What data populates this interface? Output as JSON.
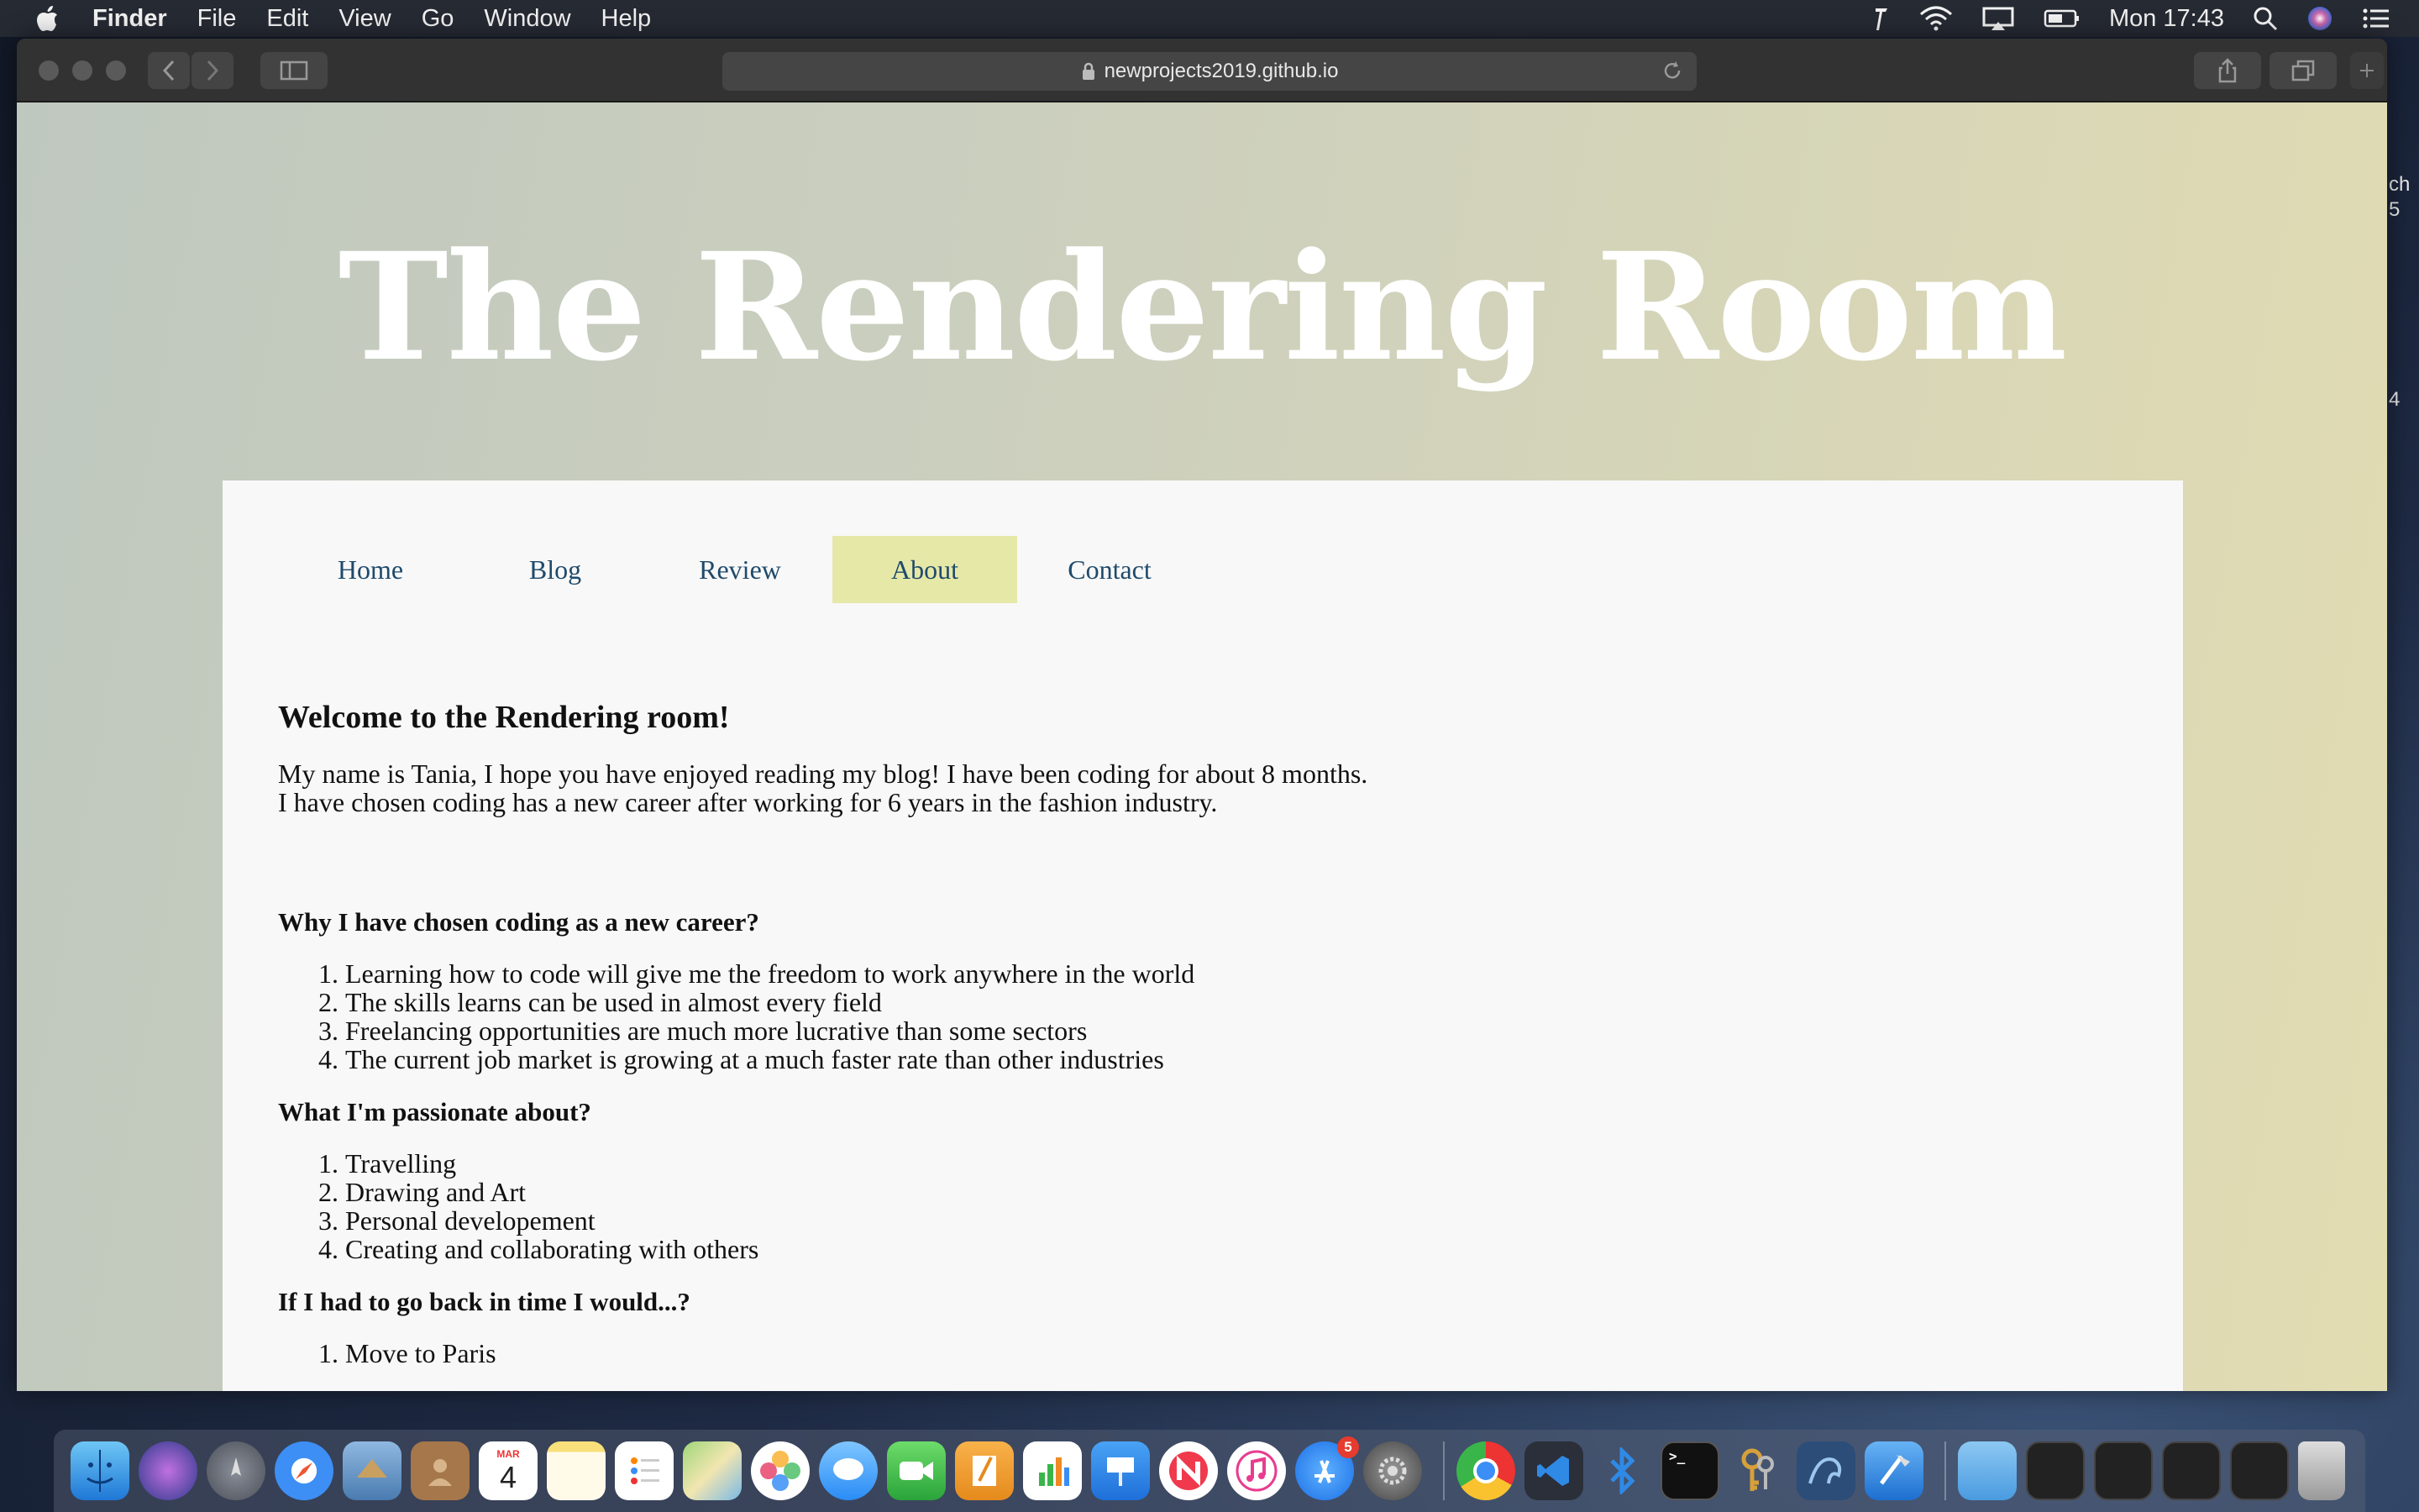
{
  "menubar": {
    "app_name": "Finder",
    "items": [
      "File",
      "Edit",
      "View",
      "Go",
      "Window",
      "Help"
    ],
    "clock": "Mon 17:43"
  },
  "browser": {
    "url": "newprojects2019.github.io"
  },
  "site": {
    "title": "The Rendering Room",
    "nav": [
      {
        "label": "Home"
      },
      {
        "label": "Blog"
      },
      {
        "label": "Review"
      },
      {
        "label": "About"
      },
      {
        "label": "Contact"
      }
    ],
    "active_nav": "About"
  },
  "article": {
    "heading": "Welcome to the Rendering room!",
    "intro_line1": "My name is Tania, I hope you have enjoyed reading my blog! I have been coding for about 8 months.",
    "intro_line2": "I have chosen coding has a new career after working for 6 years in the fashion industry.",
    "sections": [
      {
        "title": "Why I have chosen coding as a new career?",
        "items": [
          "Learning how to code will give me the freedom to work anywhere in the world",
          "The skills learns can be used in almost every field",
          "Freelancing opportunities are much more lucrative than some sectors",
          "The current job market is growing at a much faster rate than other industries"
        ]
      },
      {
        "title": "What I'm passionate about?",
        "items": [
          "Travelling",
          "Drawing and Art",
          "Personal developement",
          "Creating and collaborating with others"
        ]
      },
      {
        "title": "If I had to go back in time I would...?",
        "items": [
          "Move to Paris"
        ]
      }
    ]
  },
  "dock": {
    "calendar_month": "MAR",
    "calendar_day": "4",
    "appstore_badge": "5",
    "apps": [
      "finder-icon",
      "siri-icon",
      "launchpad-icon",
      "safari-icon",
      "mail-icon",
      "contacts-icon",
      "calendar-icon",
      "notes-icon",
      "reminders-icon",
      "maps-icon",
      "photos-icon",
      "messages-icon",
      "facetime-icon",
      "pages-icon",
      "numbers-icon",
      "keynote-icon",
      "news-icon",
      "itunes-icon",
      "app-store-icon",
      "system-preferences-icon",
      "chrome-icon",
      "vscode-icon",
      "bluetooth-icon",
      "terminal-icon",
      "keychain-icon",
      "mysql-workbench-icon",
      "xcode-icon",
      "downloads-folder-icon",
      "trash-icon"
    ]
  },
  "colors": {
    "nav_text": "#1f4a6b",
    "nav_active_bg": "#e6e8a8",
    "card_bg": "#f8f8f8"
  },
  "side_text": {
    "a": "ch",
    "b": "5",
    "c": "4"
  }
}
